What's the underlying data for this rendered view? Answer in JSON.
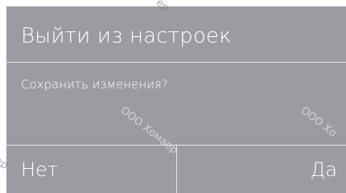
{
  "dialog": {
    "title": "Выйти из настроек",
    "message": "Сохранить изменения?",
    "buttons": {
      "no": "Нет",
      "yes": "Да"
    }
  },
  "watermark": {
    "text": "ООО Хомаер",
    "text_short": "ООО Хо",
    "fragment_top": "ер",
    "fragment_left": "ер"
  },
  "colors": {
    "dialog_bg": "#9b9ca1",
    "text": "#ffffff",
    "divider": "#e4e4e6"
  }
}
